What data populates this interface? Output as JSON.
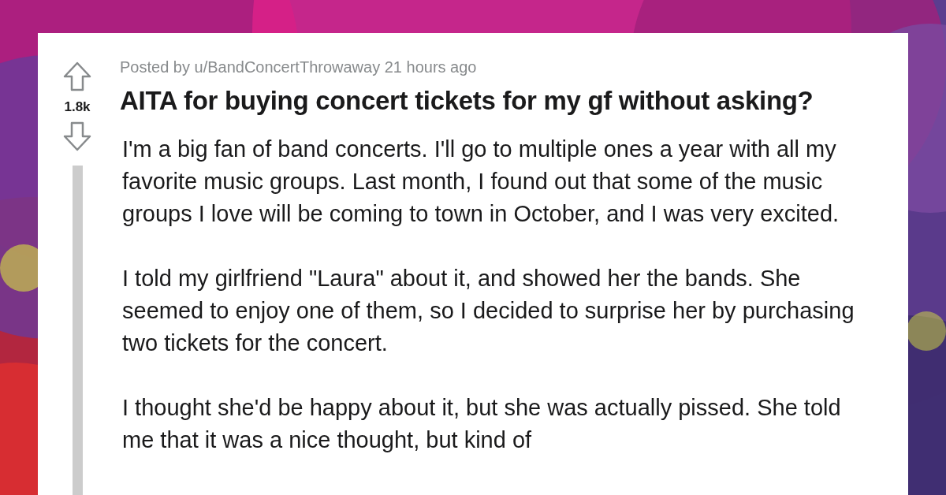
{
  "post": {
    "votes": "1.8k",
    "byline": "Posted by u/BandConcertThrowaway 21 hours ago",
    "title": "AITA for buying concert tickets for my gf without asking?",
    "paragraphs": [
      "I'm a big fan of band concerts. I'll go to multiple ones a year with all my favorite music groups. Last month, I found out that some of the music groups I love will be coming to town in October, and I was very excited.",
      "I told my girlfriend \"Laura\" about it, and showed her the bands. She seemed to enjoy one of them, so I decided to surprise her by purchasing two tickets for the concert.",
      "I thought she'd be happy about it, but she was actually pissed. She told me that it was a nice thought, but kind of"
    ]
  }
}
